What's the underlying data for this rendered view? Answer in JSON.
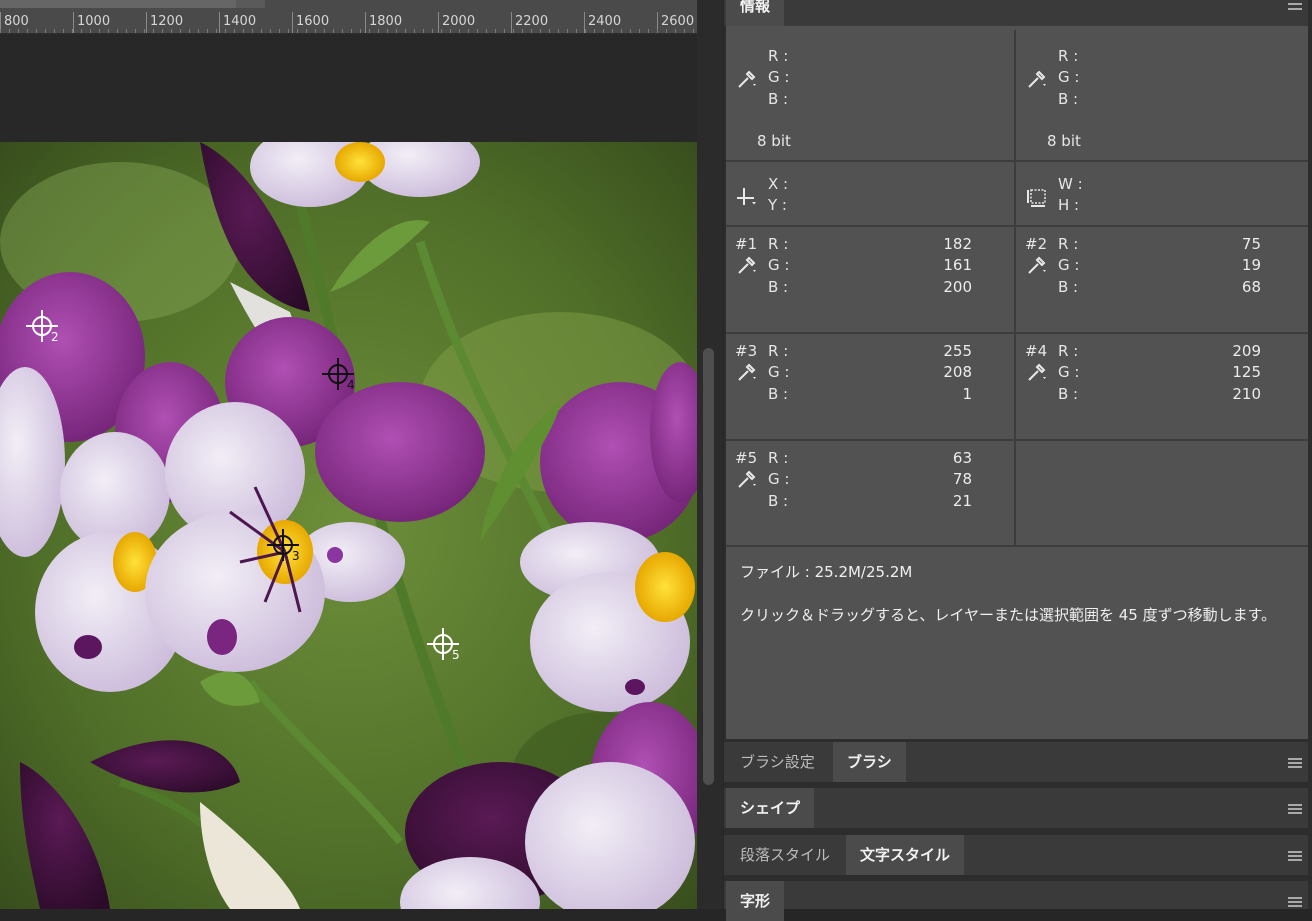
{
  "ruler": {
    "ticks": [
      "800",
      "1000",
      "1200",
      "1400",
      "1600",
      "1800",
      "2000",
      "2200",
      "2400",
      "2600"
    ]
  },
  "panel": {
    "info_tab": "情報",
    "top_readouts": {
      "left": {
        "r": "R :",
        "g": "G :",
        "b": "B :",
        "bit": "8 bit"
      },
      "right": {
        "r": "R :",
        "g": "G :",
        "b": "B :",
        "bit": "8 bit"
      }
    },
    "position": {
      "x": "X :",
      "y": "Y :"
    },
    "size": {
      "w": "W :",
      "h": "H :"
    },
    "samplers": [
      {
        "id": "#1",
        "r": "182",
        "g": "161",
        "b": "200"
      },
      {
        "id": "#2",
        "r": "75",
        "g": "19",
        "b": "68"
      },
      {
        "id": "#3",
        "r": "255",
        "g": "208",
        "b": "1"
      },
      {
        "id": "#4",
        "r": "209",
        "g": "125",
        "b": "210"
      },
      {
        "id": "#5",
        "r": "63",
        "g": "78",
        "b": "21"
      }
    ],
    "channel_labels": {
      "r": "R :",
      "g": "G :",
      "b": "B :"
    },
    "file_info": "ファイル : 25.2M/25.2M",
    "hint": "クリック＆ドラッグすると、レイヤーまたは選択範囲を 45 度ずつ移動します。",
    "brush_tabs": [
      "ブラシ設定",
      "ブラシ"
    ],
    "shape_tab": "シェイプ",
    "style_tabs": [
      "段落スタイル",
      "文字スタイル"
    ],
    "glyph_tab": "字形"
  },
  "canvas": {
    "markers": [
      "2",
      "4",
      "3",
      "5"
    ]
  },
  "colors": {
    "panel_bg": "#525252",
    "accent_purple": "#8a2e8c",
    "yellow": "#f2c200"
  }
}
